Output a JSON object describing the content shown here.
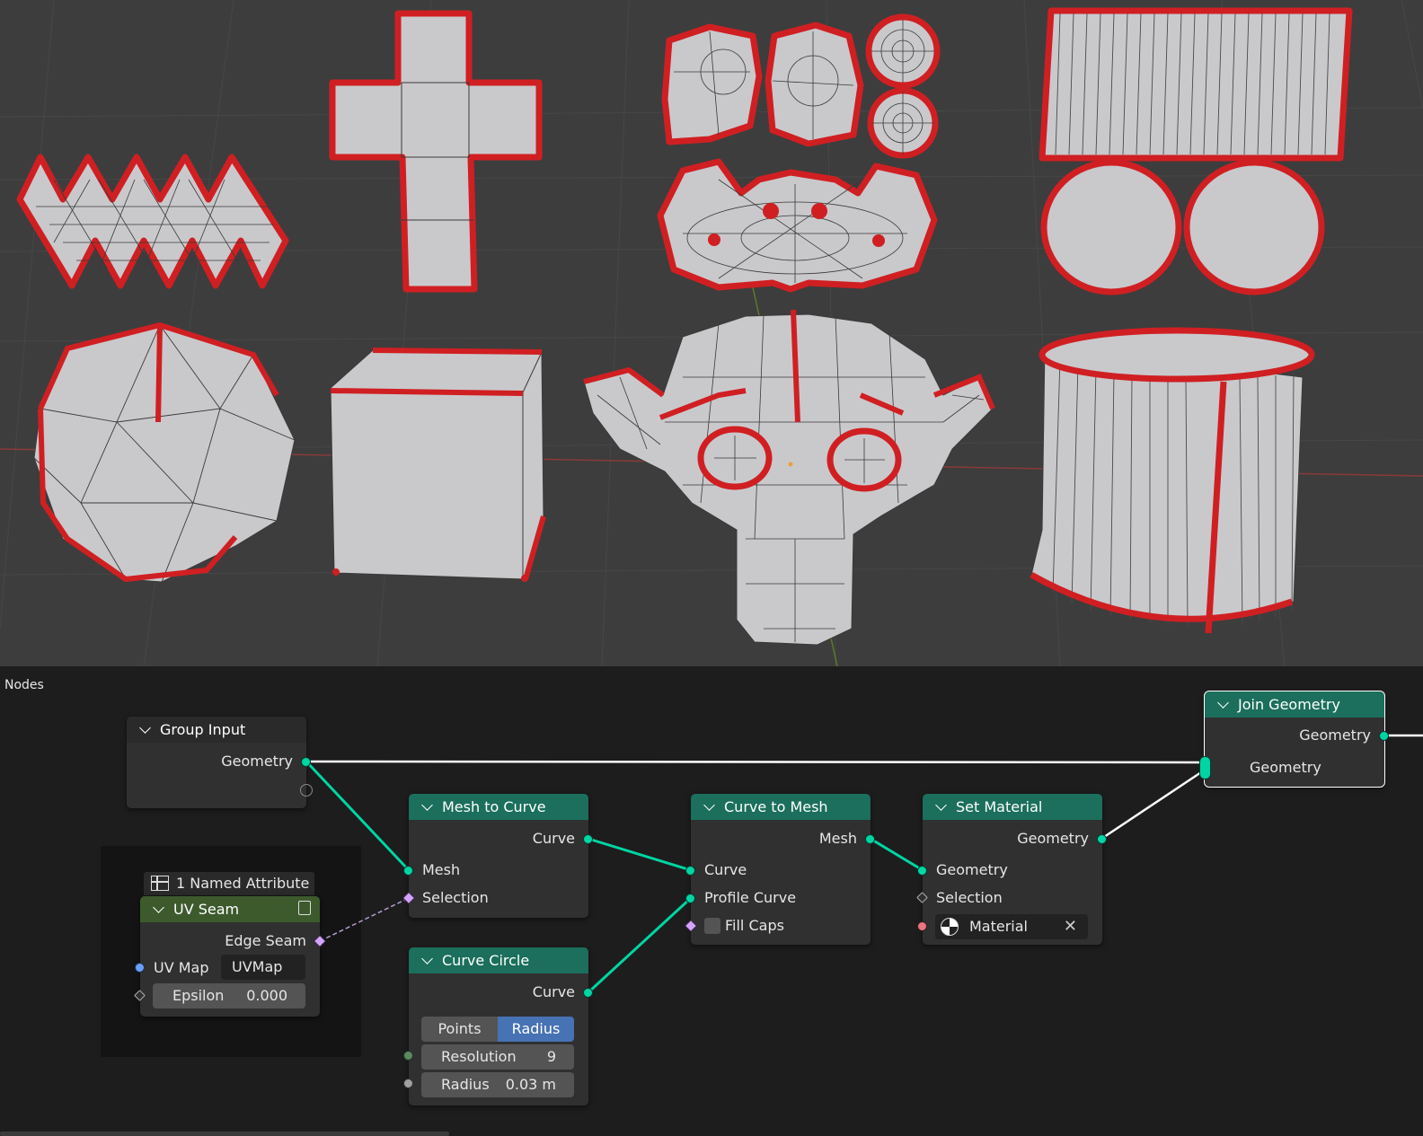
{
  "editor": {
    "title": "Nodes"
  },
  "nodes": {
    "group_input": {
      "title": "Group Input",
      "outputs": [
        "Geometry"
      ]
    },
    "named_attribute": {
      "tab_label": "1 Named Attribute",
      "title": "UV Seam",
      "output": "Edge Seam",
      "uv_map_label": "UV Map",
      "uv_map_value": "UVMap",
      "epsilon_label": "Epsilon",
      "epsilon_value": "0.000"
    },
    "mesh_to_curve": {
      "title": "Mesh to Curve",
      "output": "Curve",
      "inputs": [
        "Mesh",
        "Selection"
      ]
    },
    "curve_circle": {
      "title": "Curve Circle",
      "output": "Curve",
      "mode_options": [
        "Points",
        "Radius"
      ],
      "mode_selected": "Radius",
      "resolution_label": "Resolution",
      "resolution_value": "9",
      "radius_label": "Radius",
      "radius_value": "0.03 m"
    },
    "curve_to_mesh": {
      "title": "Curve to Mesh",
      "output": "Mesh",
      "inputs": [
        "Curve",
        "Profile Curve"
      ],
      "fill_caps_label": "Fill Caps"
    },
    "set_material": {
      "title": "Set Material",
      "output": "Geometry",
      "inputs": [
        "Geometry",
        "Selection"
      ],
      "material_label": "Material"
    },
    "join_geometry": {
      "title": "Join Geometry",
      "output": "Geometry",
      "input": "Geometry"
    }
  },
  "colors": {
    "geometry_socket": "#00d6a3",
    "geometry_header": "#1b6f5c",
    "seam_highlight": "#d01f22",
    "mesh_surface": "#c9c9cc",
    "viewport_bg": "#3d3d3d",
    "editor_bg": "#1d1d1d",
    "selected_option": "#4772b3"
  }
}
